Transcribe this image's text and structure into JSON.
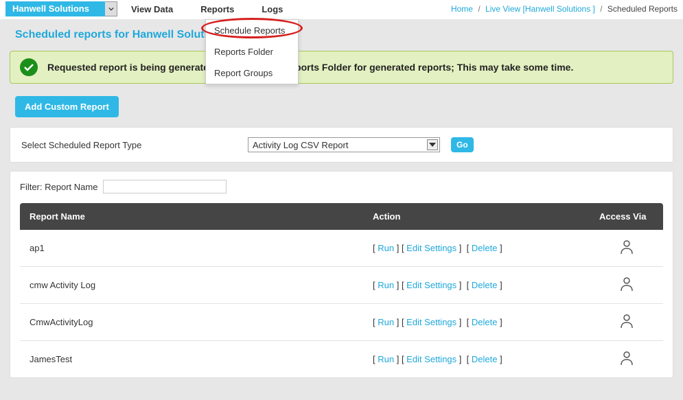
{
  "topbar": {
    "site_select": "Hanwell Solutions",
    "nav": {
      "view_data": "View Data",
      "reports": "Reports",
      "logs": "Logs"
    },
    "breadcrumb": {
      "home": "Home",
      "live_view": "Live View [Hanwell Solutions ]",
      "current": "Scheduled Reports"
    }
  },
  "dropdown": {
    "schedule_reports": "Schedule Reports",
    "reports_folder": "Reports Folder",
    "report_groups": "Report Groups"
  },
  "page": {
    "title": "Scheduled reports for Hanwell Solutions",
    "alert": "Requested report is being generated. Please check Reports Folder for generated reports; This may take some time.",
    "add_custom_btn": "Add Custom Report",
    "select_type_label": "Select Scheduled Report Type",
    "select_type_value": "Activity Log CSV Report",
    "go_btn": "Go",
    "filter_label": "Filter: Report Name",
    "filter_value": ""
  },
  "table": {
    "headers": {
      "name": "Report Name",
      "action": "Action",
      "access": "Access Via"
    },
    "actions": {
      "run": "Run",
      "edit": "Edit Settings",
      "delete": "Delete"
    },
    "rows": [
      {
        "name": "ap1"
      },
      {
        "name": "cmw Activity Log"
      },
      {
        "name": "CmwActivityLog"
      },
      {
        "name": "JamesTest"
      }
    ]
  }
}
